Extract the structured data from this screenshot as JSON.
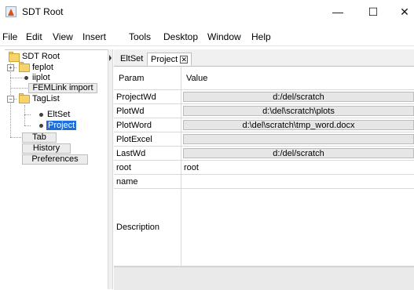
{
  "window": {
    "title": "SDT Root",
    "minimize": "—",
    "maximize": "☐",
    "close": "✕"
  },
  "menu": [
    "File",
    "Edit",
    "View",
    "Insert",
    "Tools",
    "Desktop",
    "Window",
    "Help"
  ],
  "tree": {
    "root": "SDT Root",
    "feplot": "feplot",
    "iiplot": "iiplot",
    "femlink": "FEMLink import",
    "taglist": "TagList",
    "eltset": "EltSet",
    "project": "Project",
    "tab": "Tab",
    "history": "History",
    "preferences": "Preferences"
  },
  "tabs": {
    "eltset": "EltSet",
    "project": "Project",
    "close": "✕"
  },
  "table": {
    "header": {
      "param": "Param",
      "value": "Value"
    },
    "rows": [
      {
        "param": "ProjectWd",
        "value": "d:/del/scratch"
      },
      {
        "param": "PlotWd",
        "value": "d:\\del\\scratch\\plots"
      },
      {
        "param": "PlotWord",
        "value": "d:\\del\\scratch\\tmp_word.docx"
      },
      {
        "param": "PlotExcel",
        "value": ""
      },
      {
        "param": "LastWd",
        "value": "d:/del/scratch"
      },
      {
        "param": "root",
        "value": "root"
      },
      {
        "param": "name",
        "value": ""
      },
      {
        "param": "Description",
        "value": ""
      }
    ]
  }
}
